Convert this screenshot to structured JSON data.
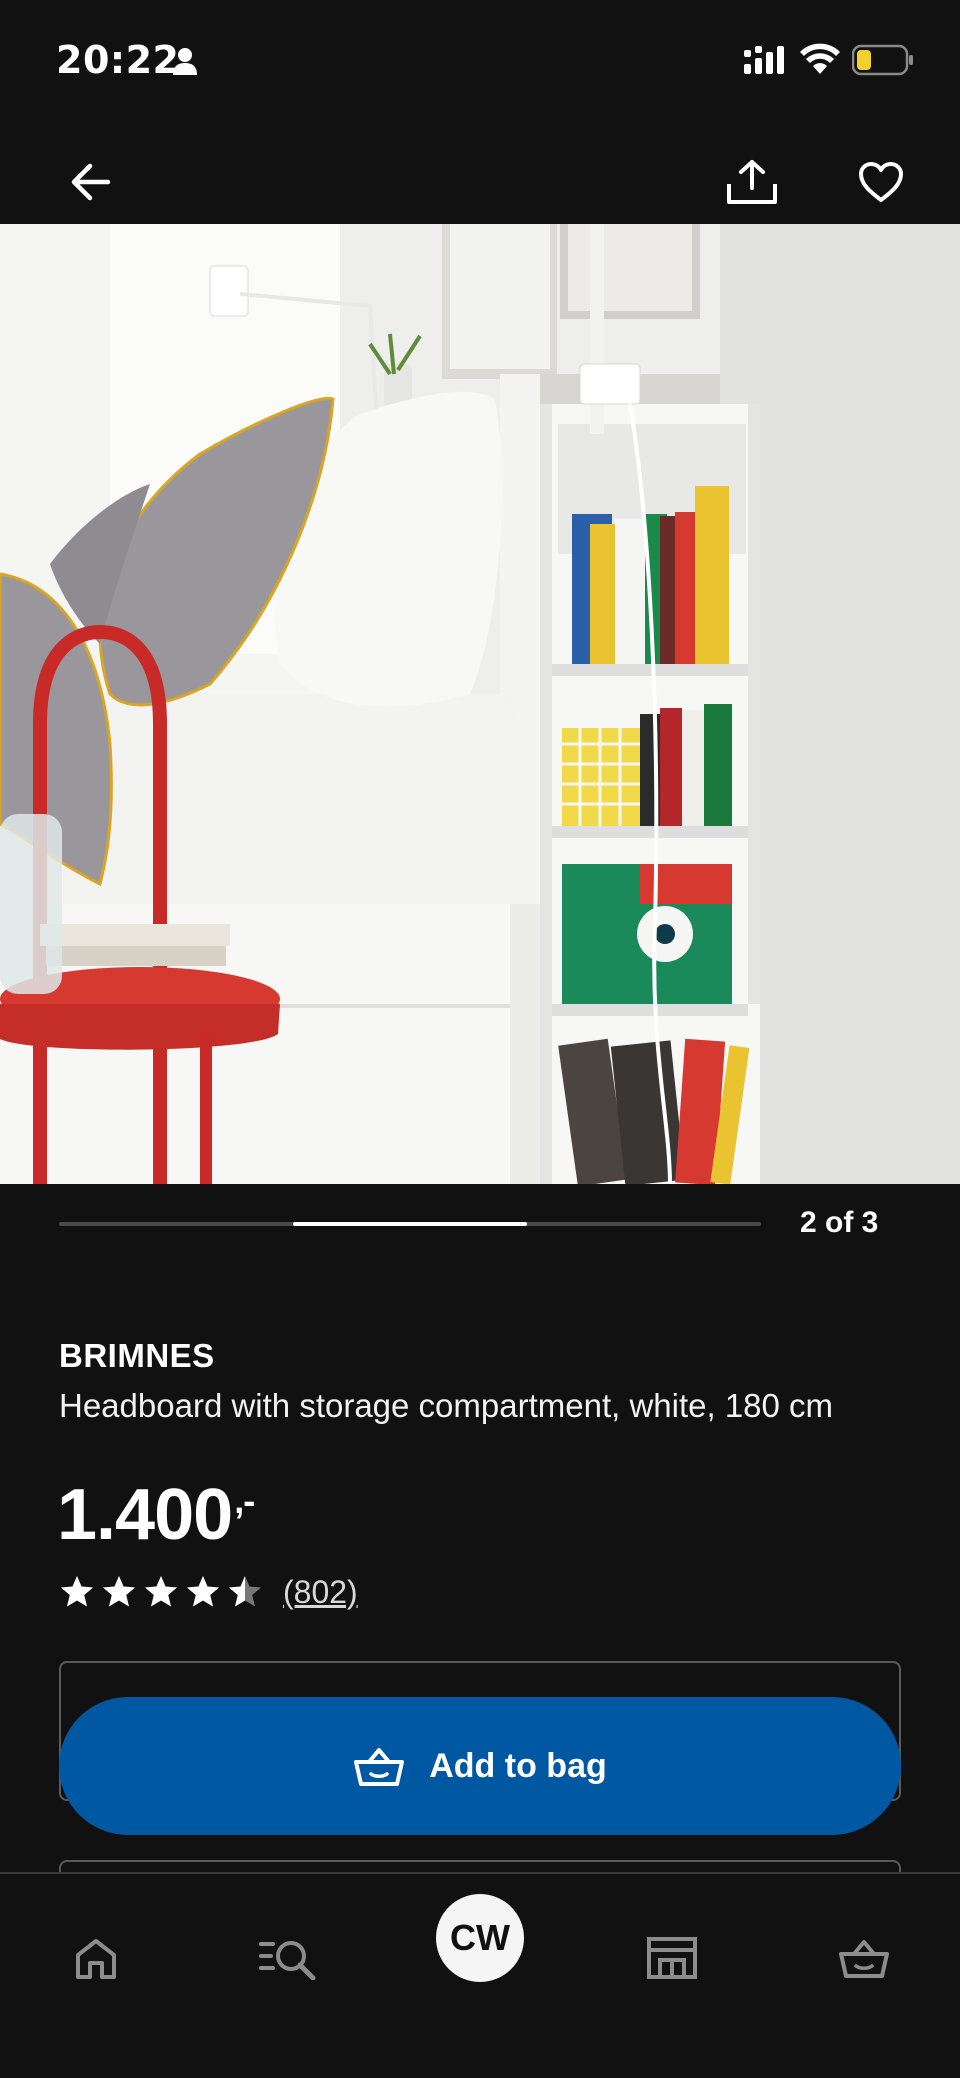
{
  "status_bar": {
    "time": "20:22"
  },
  "top_nav": {
    "back_icon": "arrow-left-icon",
    "share_icon": "share-icon",
    "favorite_icon": "heart-icon"
  },
  "image": {
    "accent_colors": [
      "#d6392f",
      "#1a8a4a",
      "#e9c330",
      "#9a979c"
    ]
  },
  "carousel": {
    "counter": "2 of 3",
    "current": 2,
    "total": 3
  },
  "product": {
    "name": "BRIMNES",
    "description": "Headboard with storage compartment, white, 180 cm",
    "price": "1.400",
    "price_suffix": ",-",
    "rating": 4.5,
    "max_rating": 5,
    "review_count": "(802)"
  },
  "cta": {
    "add_to_bag_label": "Add to bag",
    "color": "#0058a3"
  },
  "bottom_nav": {
    "items": [
      "home-icon",
      "search-icon",
      "profile",
      "store-icon",
      "bag-icon"
    ],
    "profile_initials": "CW"
  }
}
